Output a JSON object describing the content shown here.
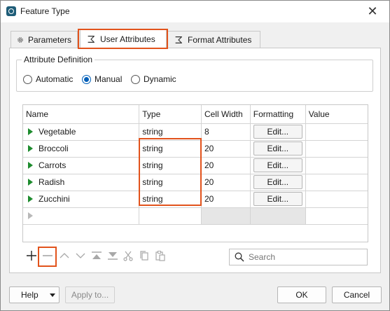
{
  "window": {
    "title": "Feature Type"
  },
  "tabs": [
    {
      "label": "Parameters",
      "icon": "gear-icon"
    },
    {
      "label": "User Attributes",
      "icon": "sigma-icon",
      "active": true
    },
    {
      "label": "Format Attributes",
      "icon": "sigma-icon"
    }
  ],
  "attribute_definition": {
    "title": "Attribute Definition",
    "options": [
      "Automatic",
      "Manual",
      "Dynamic"
    ],
    "selected": "Manual"
  },
  "table": {
    "columns": [
      "Name",
      "Type",
      "Cell Width",
      "Formatting",
      "Value"
    ],
    "rows": [
      {
        "name": "Vegetable",
        "type": "string",
        "width": "8",
        "formatting": "Edit...",
        "value": ""
      },
      {
        "name": "Broccoli",
        "type": "string",
        "width": "20",
        "formatting": "Edit...",
        "value": ""
      },
      {
        "name": "Carrots",
        "type": "string",
        "width": "20",
        "formatting": "Edit...",
        "value": ""
      },
      {
        "name": "Radish",
        "type": "string",
        "width": "20",
        "formatting": "Edit...",
        "value": ""
      },
      {
        "name": "Zucchini",
        "type": "string",
        "width": "20",
        "formatting": "Edit...",
        "value": ""
      }
    ]
  },
  "toolbar": {
    "icons": [
      "plus-icon",
      "minus-icon",
      "chevron-up-icon",
      "chevron-down-icon",
      "move-top-icon",
      "move-bottom-icon",
      "cut-icon",
      "copy-icon",
      "paste-icon"
    ],
    "search_placeholder": "Search"
  },
  "footer": {
    "help_label": "Help",
    "apply_label": "Apply to...",
    "ok_label": "OK",
    "cancel_label": "Cancel"
  },
  "colors": {
    "highlight": "#e2531c",
    "accent": "#005fb8",
    "row_arrow": "#1e8c2e"
  }
}
